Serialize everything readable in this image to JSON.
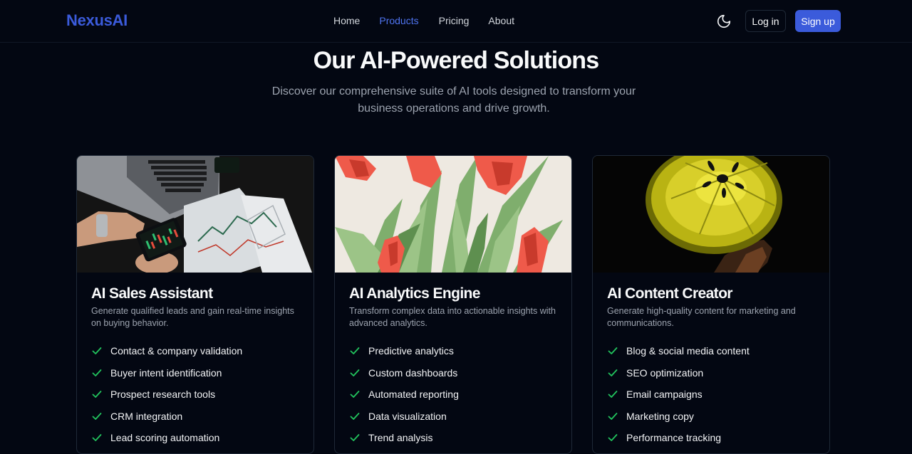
{
  "nav": {
    "logo": "NexusAI",
    "links": [
      "Home",
      "Products",
      "Pricing",
      "About"
    ],
    "active_link": "Products",
    "login_label": "Log in",
    "signup_label": "Sign up"
  },
  "hero": {
    "title": "Our AI-Powered Solutions",
    "subtitle": "Discover our comprehensive suite of AI tools designed to transform your business operations and drive growth."
  },
  "cards": [
    {
      "title": "AI Sales Assistant",
      "description": "Generate qualified leads and gain real-time insights on buying behavior.",
      "features": [
        "Contact & company validation",
        "Buyer intent identification",
        "Prospect research tools",
        "CRM integration",
        "Lead scoring automation"
      ]
    },
    {
      "title": "AI Analytics Engine",
      "description": "Transform complex data into actionable insights with advanced analytics.",
      "features": [
        "Predictive analytics",
        "Custom dashboards",
        "Automated reporting",
        "Data visualization",
        "Trend analysis"
      ]
    },
    {
      "title": "AI Content Creator",
      "description": "Generate high-quality content for marketing and communications.",
      "features": [
        "Blog & social media content",
        "SEO optimization",
        "Email campaigns",
        "Marketing copy",
        "Performance tracking"
      ]
    }
  ],
  "colors": {
    "background": "#030712",
    "accent": "#3b5bdb",
    "check": "#22c55e"
  }
}
